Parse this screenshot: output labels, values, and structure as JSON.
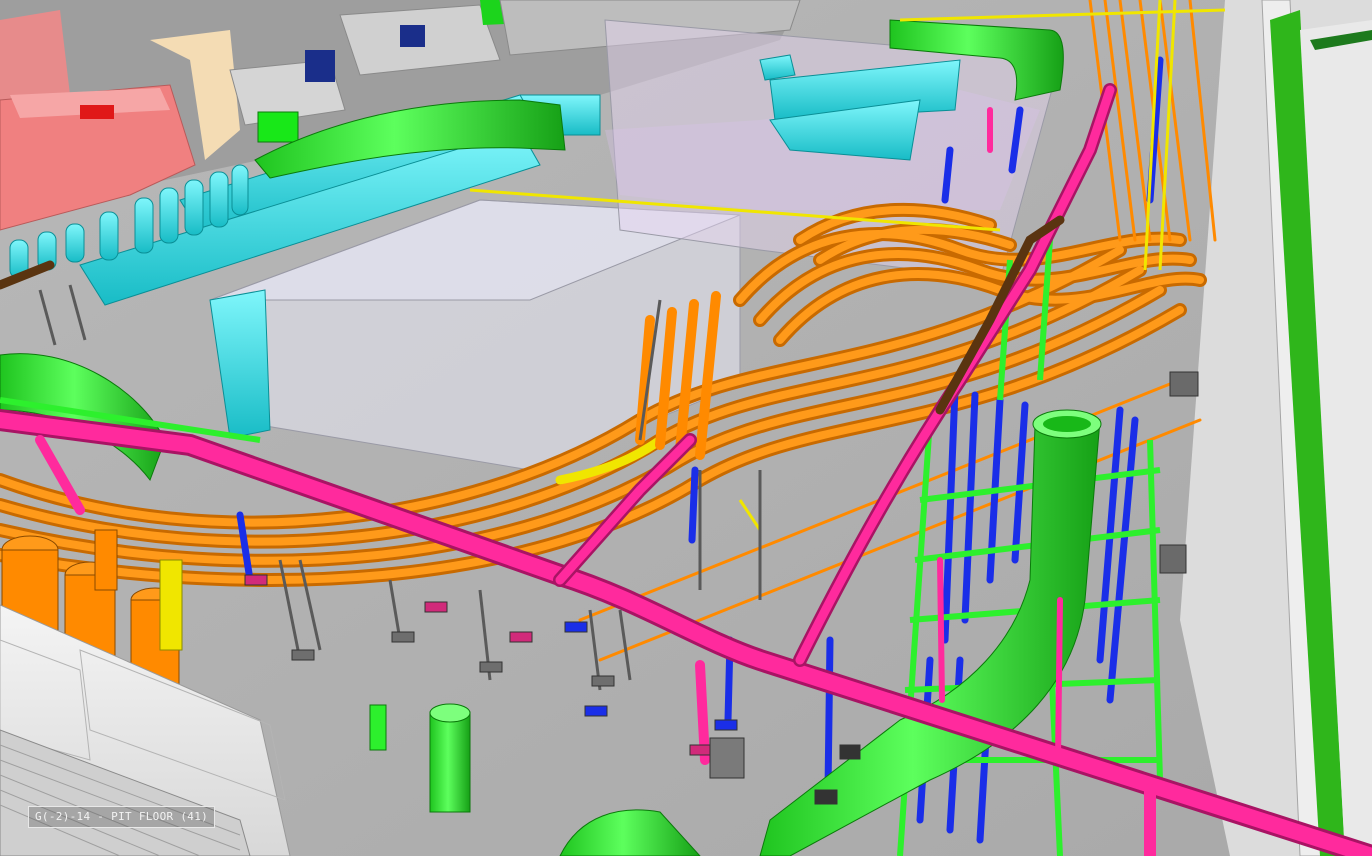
{
  "viewport": {
    "grid_label": "G(-2)-14 - PIT FLOOR (41)",
    "background": "#c9c9c9"
  },
  "colors": {
    "hvac_supply": "#2df02d",
    "chilled_water": "#ff8a00",
    "chilled_water_highlight": "#ffb347",
    "process_exhaust": "#ff2a9d",
    "ductwork": "#2de8f0",
    "domestic_water": "#1a2ee8",
    "yellow_lines": "#f0e600",
    "support_steel": "#6e6e6e",
    "room_walls": "#e6e6e6",
    "pink_room": "#f08080",
    "transparent_box": "#e8e8f4"
  },
  "icons": {
    "grid_marker": "grid-location-icon"
  }
}
